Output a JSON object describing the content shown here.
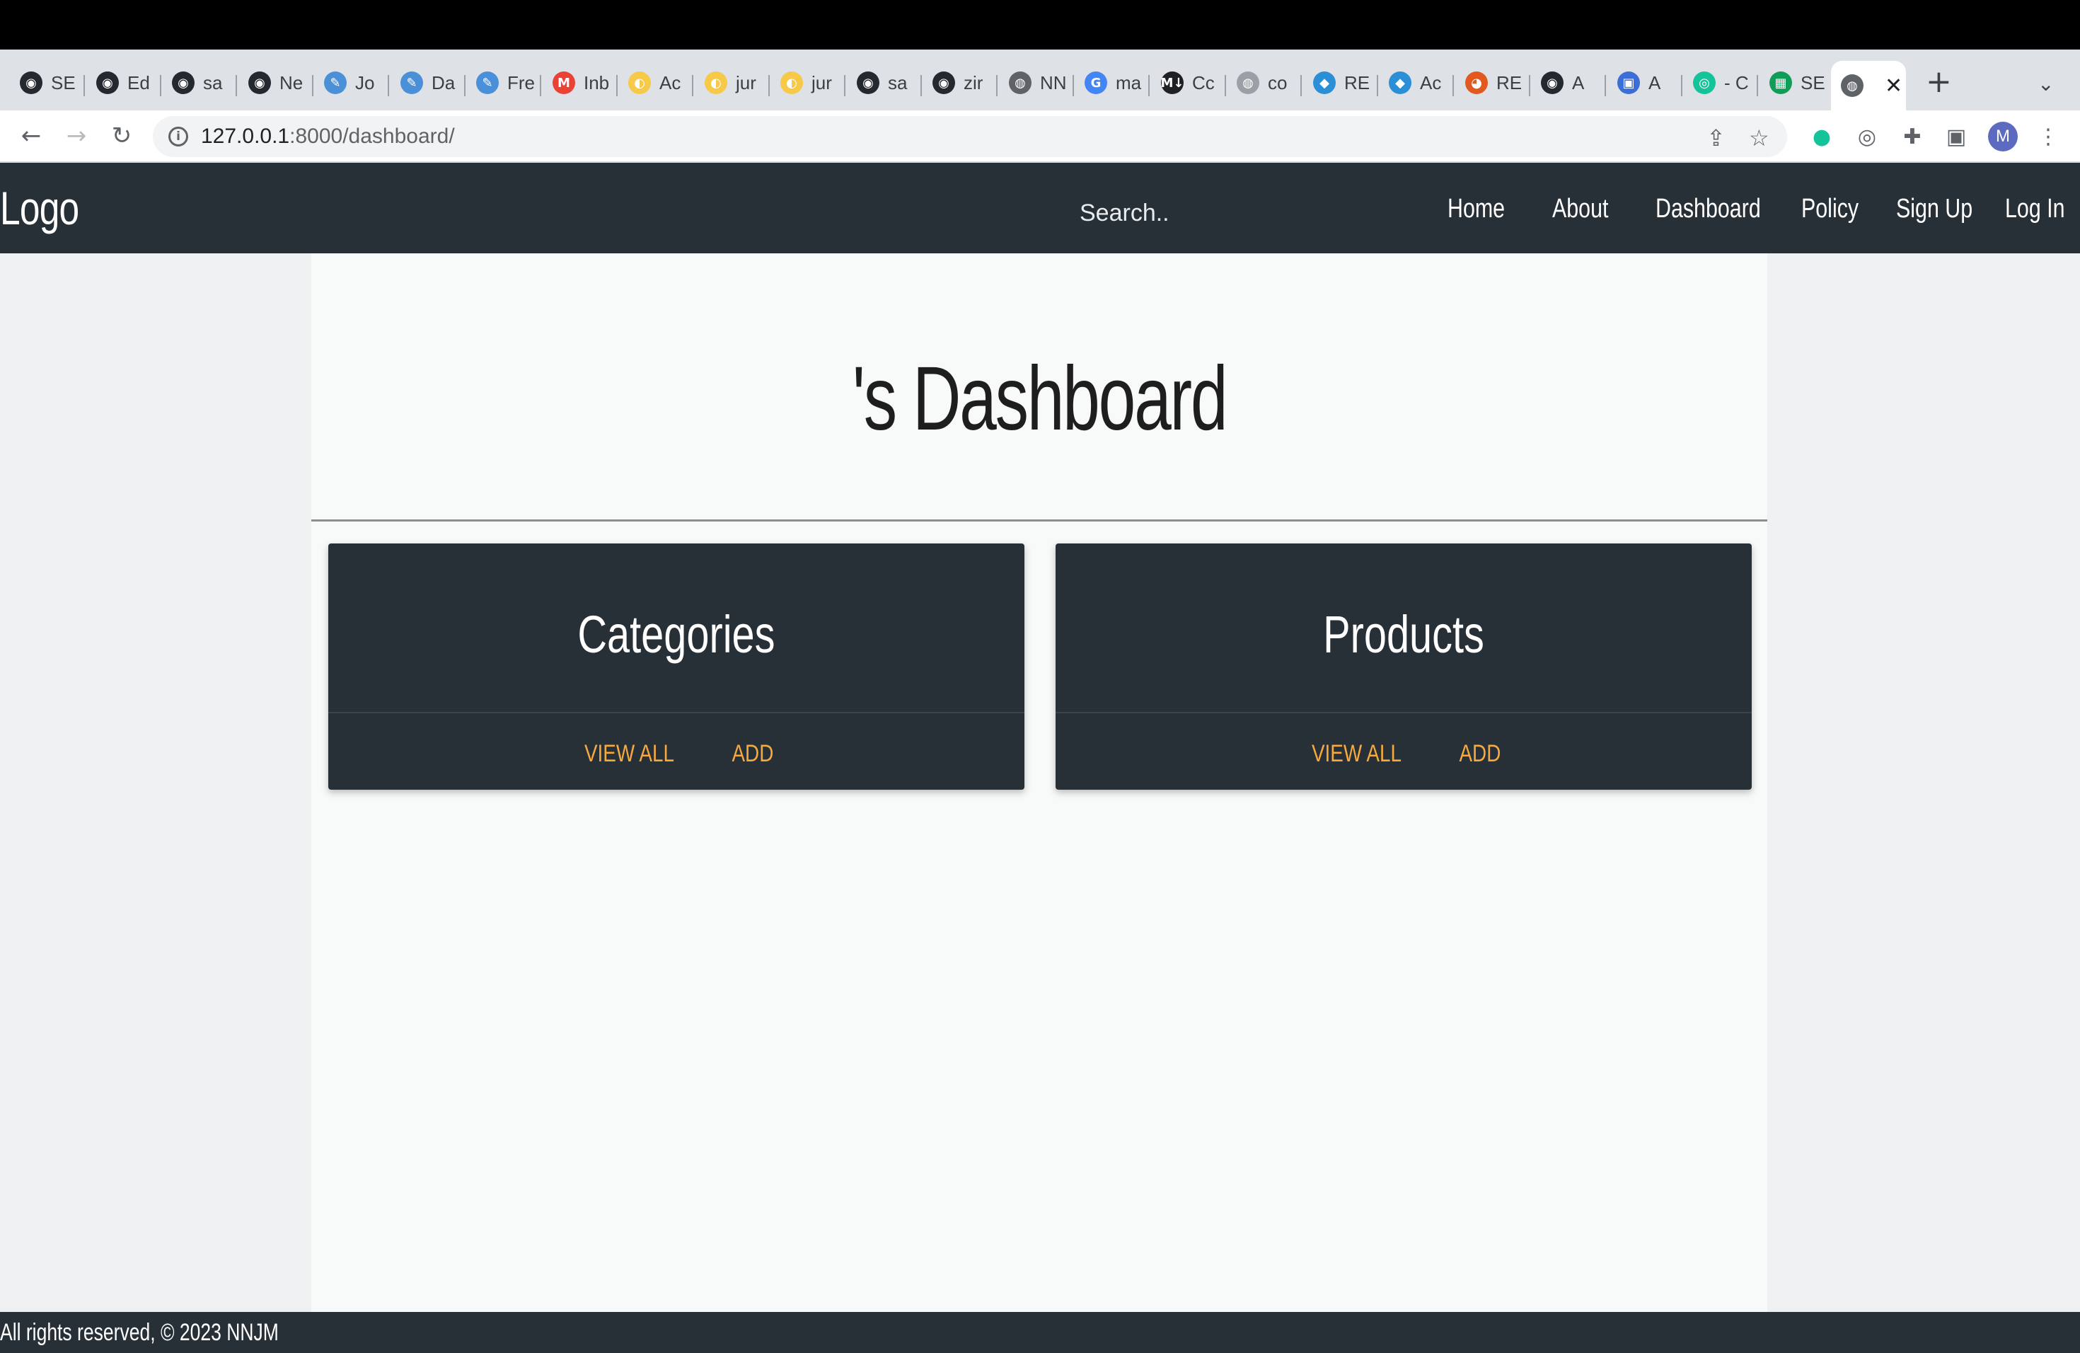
{
  "browser": {
    "tabs": [
      {
        "title": "SE",
        "icon": "github-icon",
        "color": "#24292f"
      },
      {
        "title": "Ed",
        "icon": "github-icon",
        "color": "#24292f"
      },
      {
        "title": "sa",
        "icon": "github-icon",
        "color": "#24292f"
      },
      {
        "title": "Ne",
        "icon": "github-icon",
        "color": "#24292f"
      },
      {
        "title": "Jo",
        "icon": "pen-icon",
        "color": "#4a90d9"
      },
      {
        "title": "Da",
        "icon": "pen-icon",
        "color": "#4a90d9"
      },
      {
        "title": "Fre",
        "icon": "pen-icon",
        "color": "#4a90d9"
      },
      {
        "title": "Inb",
        "icon": "gmail-icon",
        "color": "#ea4335"
      },
      {
        "title": "Ac",
        "icon": "jupyter-icon",
        "color": "#f7c948"
      },
      {
        "title": "jur",
        "icon": "jupyter-icon",
        "color": "#f7c948"
      },
      {
        "title": "jur",
        "icon": "jupyter-icon",
        "color": "#f7c948"
      },
      {
        "title": "sa",
        "icon": "github-icon",
        "color": "#24292f"
      },
      {
        "title": "zir",
        "icon": "github-icon",
        "color": "#24292f"
      },
      {
        "title": "NN",
        "icon": "globe-icon",
        "color": "#5f6368"
      },
      {
        "title": "ma",
        "icon": "google-icon",
        "color": "#4285f4"
      },
      {
        "title": "Cc",
        "icon": "markdown-icon",
        "color": "#202124"
      },
      {
        "title": "co",
        "icon": "globe-icon",
        "color": "#9aa0a6"
      },
      {
        "title": "RE",
        "icon": "drupal-icon",
        "color": "#2a8fd6"
      },
      {
        "title": "Ac",
        "icon": "drupal-icon",
        "color": "#2a8fd6"
      },
      {
        "title": "RE",
        "icon": "firefox-icon",
        "color": "#e25920"
      },
      {
        "title": "A",
        "icon": "github-icon",
        "color": "#24292f"
      },
      {
        "title": "A",
        "icon": "app-icon",
        "color": "#3b6ed6"
      },
      {
        "title": "- C",
        "icon": "grammarly-icon",
        "color": "#15c39a"
      },
      {
        "title": "SE",
        "icon": "sheets-icon",
        "color": "#0f9d58"
      }
    ],
    "active_tab": {
      "icon": "globe-icon",
      "close": "✕"
    },
    "url_host": "127.0.0.1",
    "url_rest": ":8000/dashboard/",
    "avatar_letter": "M"
  },
  "navbar": {
    "logo": "Logo",
    "search_placeholder": "Search..",
    "links": [
      "Home",
      "About",
      "Dashboard",
      "Policy",
      "Sign Up",
      "Log In"
    ]
  },
  "main": {
    "title": "'s Dashboard",
    "cards": [
      {
        "title": "Categories",
        "view_all": "View All",
        "add": "Add"
      },
      {
        "title": "Products",
        "view_all": "View All",
        "add": "Add"
      }
    ]
  },
  "footer": {
    "text": "All rights reserved, © 2023 NNJM"
  }
}
